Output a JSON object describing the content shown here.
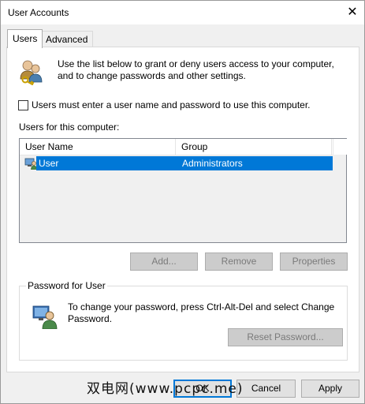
{
  "window": {
    "title": "User Accounts",
    "close_glyph": "✕"
  },
  "tabs": [
    {
      "label": "Users",
      "active": true
    },
    {
      "label": "Advanced",
      "active": false
    }
  ],
  "users_tab": {
    "intro": "Use the list below to grant or deny users access to your computer, and to change passwords and other settings.",
    "require_login_checkbox": {
      "label": "Users must enter a user name and password to use this computer.",
      "checked": false
    },
    "list_caption": "Users for this computer:",
    "columns": [
      "User Name",
      "Group"
    ],
    "rows": [
      {
        "name": "User",
        "group": "Administrators",
        "selected": true
      }
    ],
    "buttons": {
      "add": "Add...",
      "remove": "Remove",
      "properties": "Properties"
    },
    "password_group": {
      "title": "Password for User",
      "text": "To change your password, press Ctrl-Alt-Del and select Change Password.",
      "reset_button": "Reset Password..."
    }
  },
  "footer": {
    "ok": "OK",
    "cancel": "Cancel",
    "apply": "Apply"
  },
  "watermark": "双电网(www.pcpc.me)",
  "colors": {
    "selection": "#0078d7",
    "disabled_button": "#cccccc",
    "window_bg": "#f0f0f0"
  }
}
